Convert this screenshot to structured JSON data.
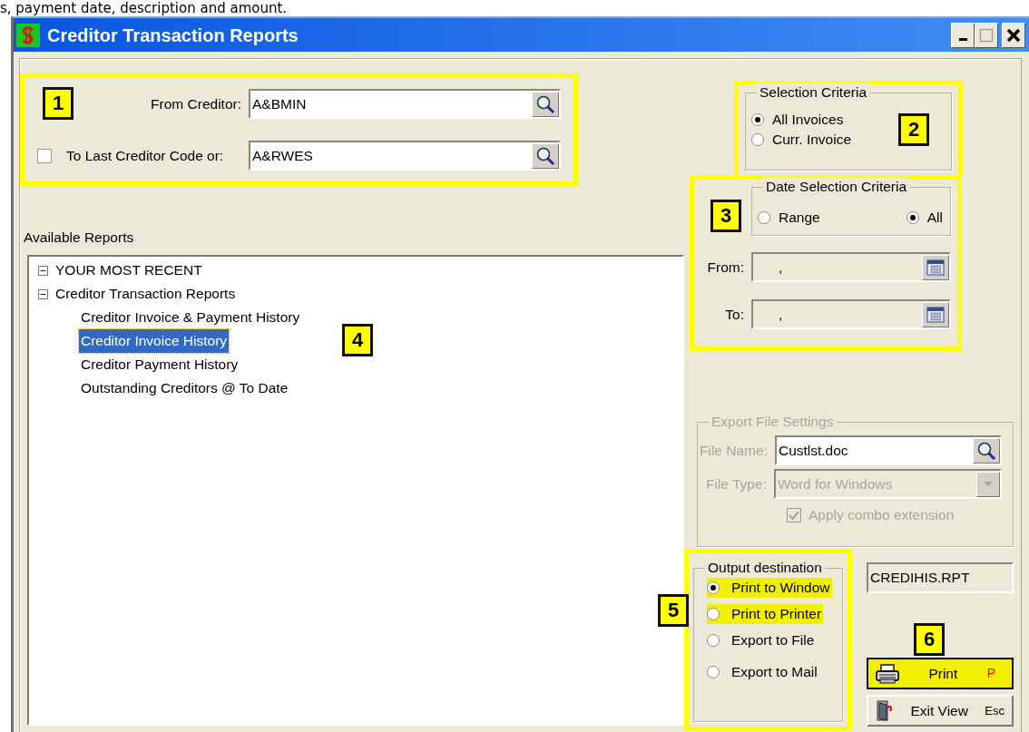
{
  "caption": "s, payment date, description and amount.",
  "window": {
    "title": "Creditor Transaction Reports"
  },
  "creditor_range": {
    "callout": "1",
    "from_label": "From Creditor:",
    "from_value": "A&BMIN",
    "to_checkbox": {
      "label": "To Last Creditor Code or:",
      "checked": false
    },
    "to_value": "A&RWES"
  },
  "selection_criteria": {
    "callout": "2",
    "title": "Selection Criteria",
    "options": [
      {
        "label": "All Invoices",
        "selected": true
      },
      {
        "label": "Curr. Invoice",
        "selected": false
      }
    ]
  },
  "date_selection": {
    "callout": "3",
    "title": "Date Selection Criteria",
    "options": [
      {
        "label": "Range",
        "selected": false
      },
      {
        "label": "All",
        "selected": true
      }
    ],
    "fields": [
      {
        "label": "From:",
        "value": ",",
        "disabled": true
      },
      {
        "label": "To:",
        "value": ",",
        "disabled": true
      }
    ]
  },
  "available_reports": {
    "callout": "4",
    "label": "Available Reports",
    "tree": [
      {
        "label": "YOUR MOST RECENT",
        "expanded": true,
        "selected": false
      },
      {
        "label": "Creditor Transaction Reports",
        "expanded": true,
        "selected": false,
        "children": [
          {
            "label": "Creditor Invoice & Payment History",
            "selected": false
          },
          {
            "label": "Creditor Invoice History",
            "selected": true
          },
          {
            "label": "Creditor Payment History",
            "selected": false
          },
          {
            "label": "Outstanding Creditors @ To Date",
            "selected": false
          }
        ]
      }
    ]
  },
  "export_settings": {
    "title": "Export  File Settings",
    "disabled": true,
    "file_name_label": "File Name:",
    "file_name": "Custlst.doc",
    "file_type_label": "File Type:",
    "file_type": "Word for Windows",
    "apply_combo": {
      "label": "Apply combo extension",
      "checked": true
    }
  },
  "output_destination": {
    "callout": "5",
    "title": "Output destination",
    "options": [
      {
        "label": "Print to Window",
        "selected": true,
        "highlighted": true
      },
      {
        "label": "Print to Printer",
        "selected": false,
        "highlighted": true
      },
      {
        "label": "Export to File",
        "selected": false,
        "highlighted": false
      },
      {
        "label": "Export to Mail",
        "selected": false,
        "highlighted": false
      }
    ]
  },
  "report_file": "CREDIHIS.RPT",
  "actions": {
    "callout": "6",
    "buttons": [
      {
        "kind": "print",
        "label": "Print",
        "shortcut": "P",
        "highlighted": true
      },
      {
        "kind": "exit",
        "label": "Exit View",
        "shortcut": "Esc",
        "highlighted": false
      }
    ]
  }
}
